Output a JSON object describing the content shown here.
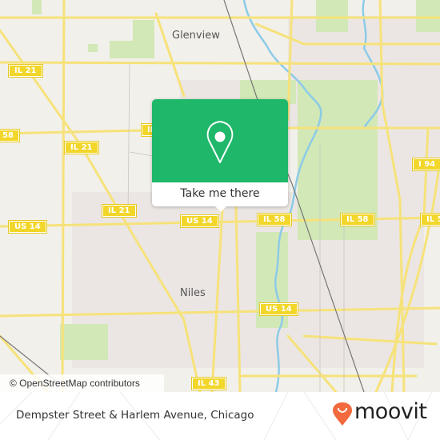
{
  "map": {
    "place_labels": [
      {
        "id": "glenview",
        "text": "Glenview"
      },
      {
        "id": "niles",
        "text": "Niles"
      }
    ],
    "route_shields": [
      {
        "id": "il21-a",
        "text": "IL 21"
      },
      {
        "id": "il21-b",
        "text": "IL 21"
      },
      {
        "id": "il21-c",
        "text": "IL 21"
      },
      {
        "id": "il58-a",
        "text": "58"
      },
      {
        "id": "il58-b",
        "text": "IL"
      },
      {
        "id": "il58-c",
        "text": "IL 58"
      },
      {
        "id": "il58-d",
        "text": "IL 58"
      },
      {
        "id": "il58-e",
        "text": "IL 5"
      },
      {
        "id": "us14-a",
        "text": "US 14"
      },
      {
        "id": "us14-b",
        "text": "US 14"
      },
      {
        "id": "us14-c",
        "text": "US 14"
      },
      {
        "id": "i94",
        "text": "I 94"
      },
      {
        "id": "il43",
        "text": "IL 43"
      }
    ],
    "attribution": "© OpenStreetMap contributors",
    "colors": {
      "land": "#f2f0ea",
      "urban": "#ece8e4",
      "park": "#cfe6b0",
      "water": "#8ccbe8",
      "road": "#f6e27a",
      "rail": "#777777"
    }
  },
  "popup": {
    "icon": "location-pin-icon",
    "button_label": "Take me there",
    "accent_color": "#1fb76a"
  },
  "footer": {
    "location_text": "Dempster Street & Harlem Avenue, Chicago",
    "brand": "moovit",
    "brand_color": "#f26a3d"
  }
}
